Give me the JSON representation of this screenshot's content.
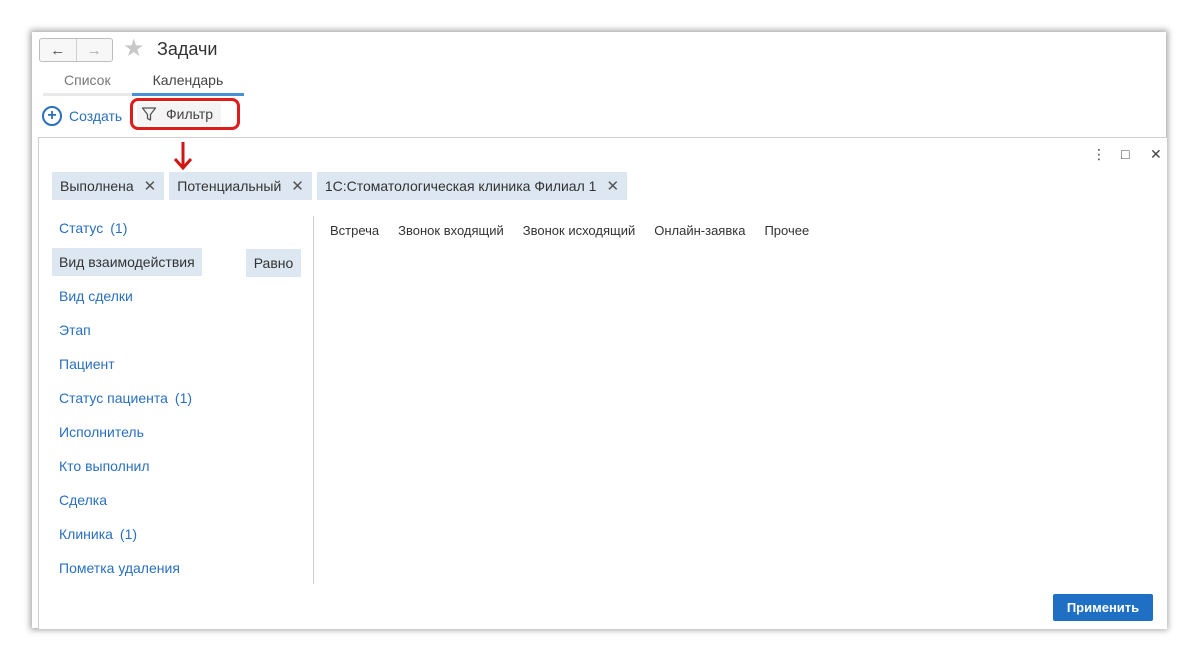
{
  "window": {
    "title": "Задачи",
    "back_icon": "←",
    "forward_icon": "→",
    "star_icon": "★"
  },
  "tabs": [
    {
      "label": "Список",
      "active": false
    },
    {
      "label": "Календарь",
      "active": true
    }
  ],
  "toolbar": {
    "create_label": "Создать",
    "create_icon": "+",
    "filter_label": "Фильтр"
  },
  "panel": {
    "menu_icon": "⋮",
    "maximize_icon": "□",
    "close_icon": "✕",
    "chips": [
      {
        "label": "Выполнена",
        "remove_icon": "✕"
      },
      {
        "label": "Потенциальный",
        "remove_icon": "✕"
      },
      {
        "label": "1С:Стоматологическая клиника Филиал 1",
        "remove_icon": "✕"
      }
    ],
    "fields": [
      {
        "label": "Статус",
        "count": "(1)"
      },
      {
        "label": "Вид взаимодействия",
        "count": "",
        "selected": true
      },
      {
        "label": "Вид сделки",
        "count": ""
      },
      {
        "label": "Этап",
        "count": ""
      },
      {
        "label": "Пациент",
        "count": ""
      },
      {
        "label": "Статус пациента",
        "count": "(1)"
      },
      {
        "label": "Исполнитель",
        "count": ""
      },
      {
        "label": "Кто выполнил",
        "count": ""
      },
      {
        "label": "Сделка",
        "count": ""
      },
      {
        "label": "Клиника",
        "count": "(1)"
      },
      {
        "label": "Пометка удаления",
        "count": ""
      }
    ],
    "condition_label": "Равно",
    "values": [
      "Встреча",
      "Звонок входящий",
      "Звонок исходящий",
      "Онлайн-заявка",
      "Прочее"
    ],
    "apply_label": "Применить"
  },
  "colors": {
    "accent": "#2a6fbe",
    "highlight": "#e11a1a",
    "chip_bg": "#dde7f1",
    "apply_bg": "#1f6fc5"
  }
}
